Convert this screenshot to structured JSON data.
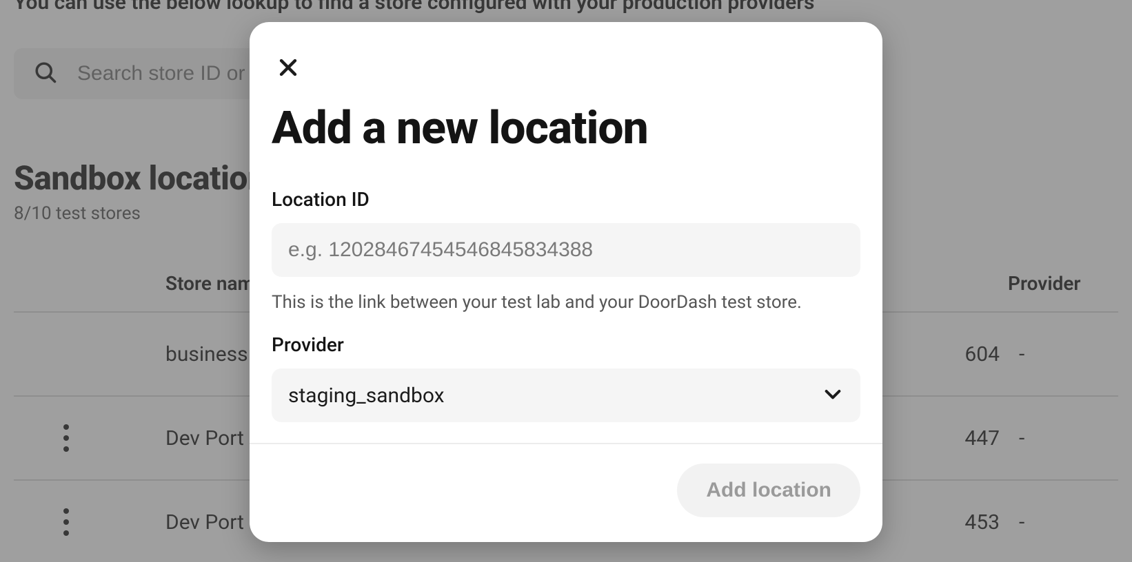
{
  "background": {
    "instruction": "You can use the below lookup to find a store configured with your production providers",
    "search_placeholder": "Search store ID or",
    "heading": "Sandbox location",
    "subheading": "8/10 test stores",
    "columns": {
      "store_name": "Store nam",
      "provider": "Provider"
    },
    "rows": [
      {
        "name": "business",
        "mid": "604",
        "provider": "-",
        "has_menu": false
      },
      {
        "name": "Dev Port",
        "mid": "447",
        "provider": "-",
        "has_menu": true
      },
      {
        "name": "Dev Port",
        "mid": "453",
        "provider": "-",
        "has_menu": true
      }
    ]
  },
  "modal": {
    "title": "Add a new location",
    "location_id": {
      "label": "Location ID",
      "placeholder": "e.g. 12028467454546845834388",
      "help": "This is the link between your test lab and your DoorDash test store."
    },
    "provider": {
      "label": "Provider",
      "selected": "staging_sandbox"
    },
    "submit_label": "Add location"
  }
}
